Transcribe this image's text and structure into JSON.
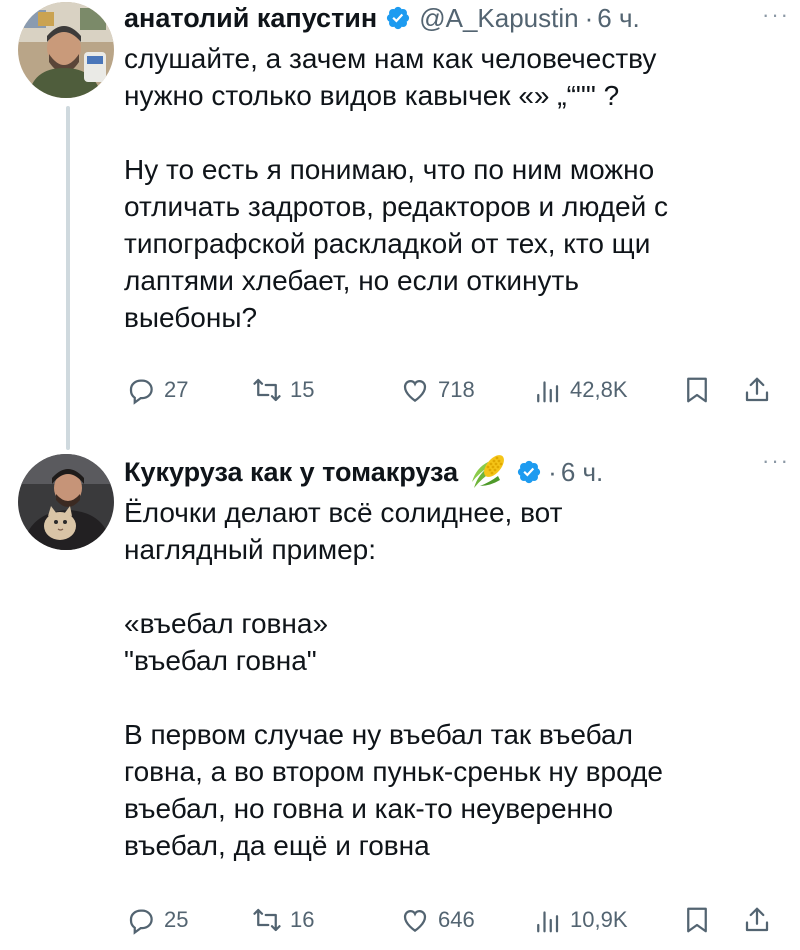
{
  "tweets": [
    {
      "author_name": "анатолий капустин",
      "handle": "@A_Kapustin",
      "separator": "·",
      "time": "6 ч.",
      "verified": true,
      "avatar_icon": "person-photo",
      "more_icon": "more-dots-icon",
      "paragraphs": [
        [
          "слушайте, а зачем нам как человечеству",
          "нужно столько видов кавычек «» „“\"\" ?"
        ],
        [
          "Ну то есть я понимаю, что по ним можно",
          "отличать задротов, редакторов и людей с",
          "типографской раскладкой от тех, кто щи",
          "лаптями хлебает, но если откинуть",
          "выебоны?"
        ]
      ],
      "stats": {
        "replies": "27",
        "retweets": "15",
        "likes": "718",
        "views": "42,8K"
      }
    },
    {
      "author_name": "Кукуруза как у томакруза",
      "emoji": "corn-emoji",
      "separator": "·",
      "time": "6 ч.",
      "verified": true,
      "avatar_icon": "person-with-cat-photo",
      "more_icon": "more-dots-icon",
      "paragraphs": [
        [
          "Ёлочки делают всё солиднее, вот",
          "наглядный пример:"
        ],
        [
          "«въебал говна»",
          "\"въебал говна\""
        ],
        [
          "В первом случае ну въебал так въебал",
          "говна, а во втором пуньк-среньк ну вроде",
          "въебал, но говна и как-то неуверенно",
          "въебал, да ещё и говна"
        ]
      ],
      "stats": {
        "replies": "25",
        "retweets": "16",
        "likes": "646",
        "views": "10,9K"
      }
    }
  ],
  "colors": {
    "text": "#0f1419",
    "secondary": "#536471",
    "verified_blue": "#1d9bf0",
    "thread_line": "#cfd9de"
  },
  "more_label": "···"
}
